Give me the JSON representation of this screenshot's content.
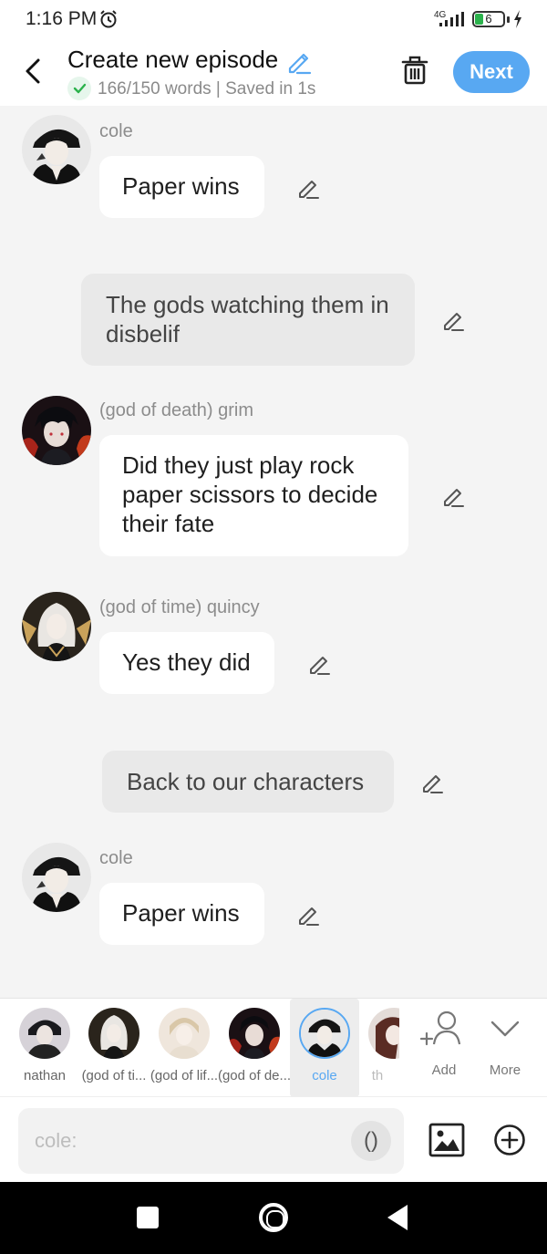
{
  "status": {
    "time": "1:16 PM",
    "network": "4G",
    "battery": "6"
  },
  "header": {
    "title": "Create new episode",
    "status_text": "166/150 words | Saved in 1s",
    "next_label": "Next"
  },
  "messages": [
    {
      "type": "dialogue",
      "speaker": "cole",
      "text": "Paper wins"
    },
    {
      "type": "narration",
      "text": "The gods watching them in disbelif"
    },
    {
      "type": "dialogue",
      "speaker": "(god of death) grim",
      "text": "Did they just play rock paper scissors to decide their fate"
    },
    {
      "type": "dialogue",
      "speaker": "(god of time) quincy",
      "text": "Yes they did"
    },
    {
      "type": "narration",
      "text": "Back to our characters"
    },
    {
      "type": "dialogue",
      "speaker": "cole",
      "text": "Paper wins"
    }
  ],
  "characters": [
    {
      "label": "nathan",
      "selected": false
    },
    {
      "label": "(god of ti...",
      "selected": false
    },
    {
      "label": "(god of lif...",
      "selected": false
    },
    {
      "label": "(god of de...",
      "selected": false
    },
    {
      "label": "cole",
      "selected": true
    },
    {
      "label": "th",
      "selected": false
    }
  ],
  "tools": {
    "add_label": "Add",
    "more_label": "More"
  },
  "input": {
    "placeholder": "cole:",
    "paren_label": "()"
  },
  "colors": {
    "accent": "#58a8f2",
    "bubble": "#ffffff",
    "narration": "#e9e9e9",
    "background": "#f4f4f4"
  }
}
